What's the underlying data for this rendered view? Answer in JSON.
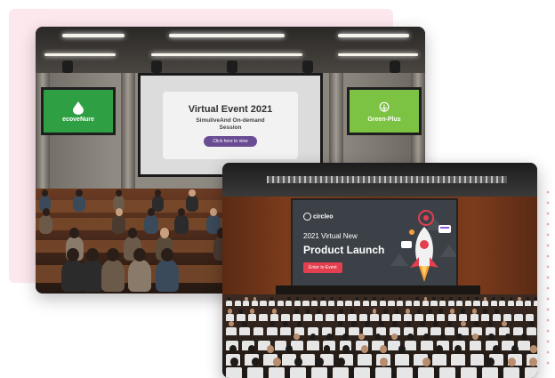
{
  "scene1": {
    "left_screen": {
      "label": "ecoveNure",
      "color": "#2ea043",
      "icon": "drop-logo-icon"
    },
    "right_screen": {
      "label": "Green-Plus",
      "color": "#7cc243",
      "icon": "tree-logo-icon"
    },
    "main_screen": {
      "title": "Virtual Event 2021",
      "subtitle_line1": "SimuliveAnd On-demand",
      "subtitle_line2": "Session",
      "button_label": "Click here to view",
      "button_color": "#6a4c93"
    }
  },
  "scene2": {
    "main_screen": {
      "brand": "circleo",
      "line1": "2021 Virtual New",
      "line2": "Product Launch",
      "button_label": "Enter to Event",
      "button_color": "#e43f4f",
      "icon": "rocket-icon"
    }
  },
  "colors": {
    "pink_card": "#fde8ee",
    "dots": "#f2b6c5"
  }
}
